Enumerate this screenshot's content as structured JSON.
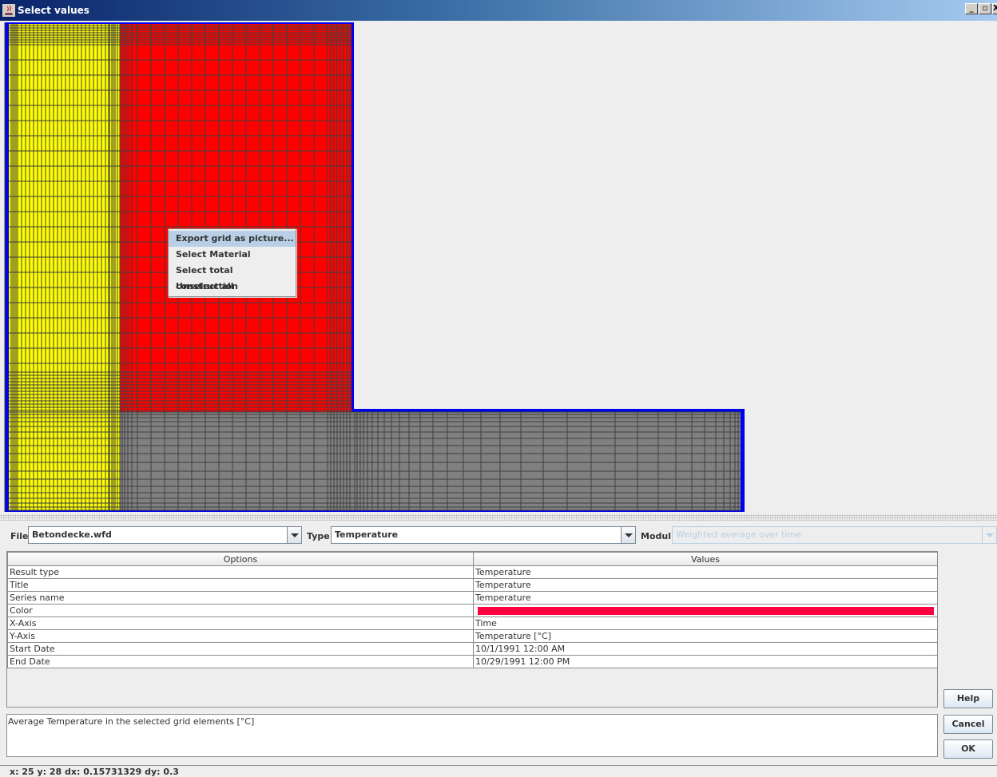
{
  "window": {
    "title": "Select values",
    "controls": [
      "_",
      "̅□",
      "X"
    ]
  },
  "grid": {
    "materials": [
      {
        "name": "yellow-material",
        "color": "#ffff00"
      },
      {
        "name": "red-material",
        "color": "#ff0000"
      },
      {
        "name": "gray-material",
        "color": "#808080"
      }
    ],
    "selected_border_color": "#0000ee",
    "line_color": "#404040"
  },
  "context_menu": {
    "items": [
      {
        "label": "Export grid as picture...",
        "highlighted": true
      },
      {
        "label": "Select Material",
        "highlighted": false
      },
      {
        "label": "Select total construction",
        "highlighted": false
      },
      {
        "label": "Unselect all",
        "highlighted": false
      }
    ]
  },
  "selectors": {
    "file_label": "File",
    "file_value": "Betondecke.wfd",
    "type_label": "Type",
    "type_value": "Temperature",
    "modul_label": "Modul",
    "modul_value": "Weighted average over time"
  },
  "table": {
    "headers": [
      "Options",
      "Values"
    ],
    "rows": [
      {
        "option": "Result type",
        "value": "Temperature"
      },
      {
        "option": "Title",
        "value": "Temperature"
      },
      {
        "option": "Series name",
        "value": "Temperature"
      },
      {
        "option": "Color",
        "value": "",
        "color": "#ff0040"
      },
      {
        "option": "X-Axis",
        "value": "Time"
      },
      {
        "option": "Y-Axis",
        "value": "Temperature [°C]"
      },
      {
        "option": "Start Date",
        "value": "10/1/1991 12:00 AM"
      },
      {
        "option": "End Date",
        "value": "10/29/1991 12:00 PM"
      }
    ]
  },
  "description": "Average Temperature in the selected grid elements [°C]",
  "buttons": {
    "help": "Help",
    "cancel": "Cancel",
    "ok": "OK"
  },
  "status": "x: 25 y: 28 dx: 0.15731329 dy: 0.3"
}
